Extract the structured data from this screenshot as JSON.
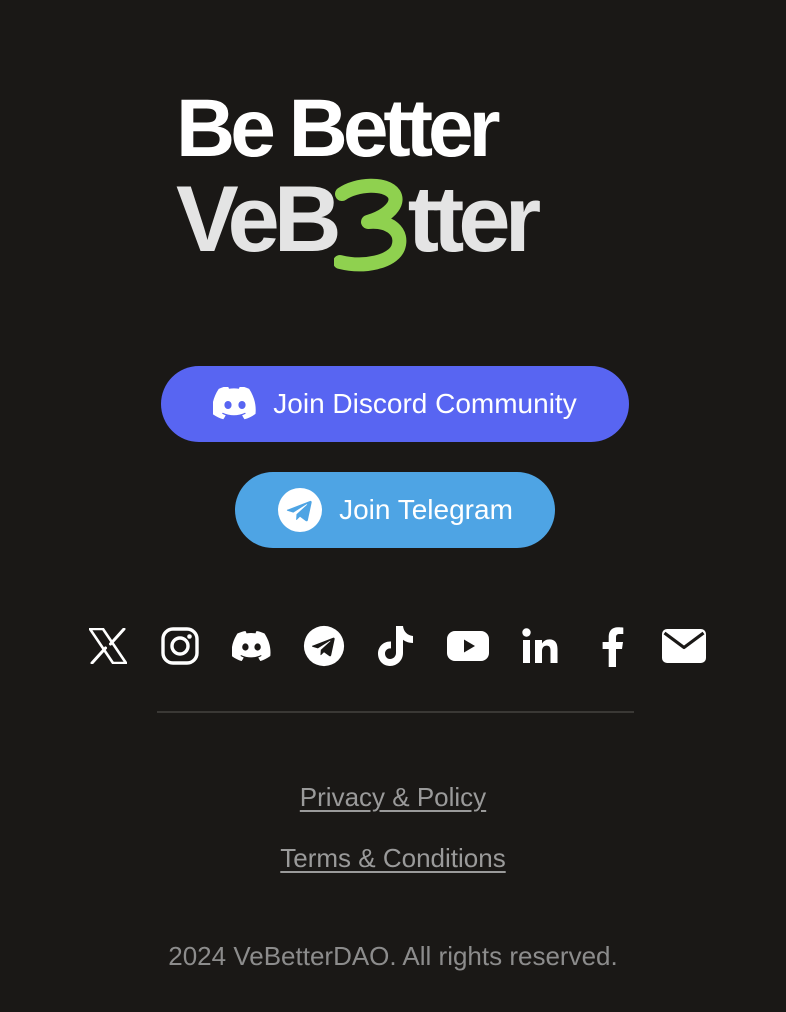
{
  "logo": {
    "line1": "Be Better",
    "line2_prefix": "VeB",
    "line2_suffix": "tter",
    "accent_color": "#8fd14f"
  },
  "buttons": {
    "discord": {
      "label": "Join Discord Community",
      "icon": "discord-icon",
      "color": "#5865f2"
    },
    "telegram": {
      "label": "Join Telegram",
      "icon": "telegram-icon",
      "color": "#4ea4e4"
    }
  },
  "socials": [
    "x-icon",
    "instagram-icon",
    "discord-icon",
    "telegram-icon",
    "tiktok-icon",
    "youtube-icon",
    "linkedin-icon",
    "facebook-icon",
    "email-icon"
  ],
  "links": {
    "privacy": "Privacy & Policy",
    "terms": "Terms & Conditions"
  },
  "footer": {
    "copyright": "2024 VeBetterDAO. All rights reserved."
  }
}
